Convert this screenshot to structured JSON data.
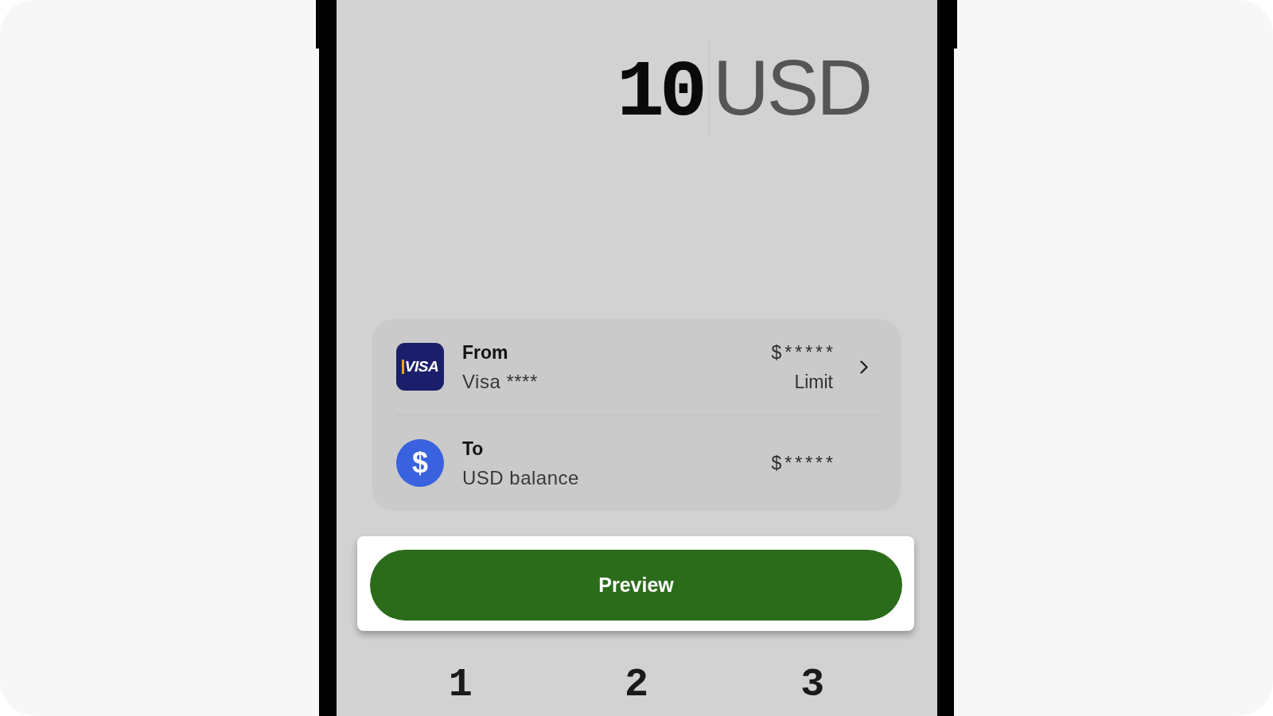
{
  "amount": {
    "value": "10",
    "currency": "USD"
  },
  "transfer": {
    "rows": [
      {
        "kind": "card",
        "logo": "VISA",
        "label": "From",
        "account": "Visa ****",
        "amount": "$*****",
        "note": "Limit"
      },
      {
        "kind": "balance",
        "logo": "$",
        "label": "To",
        "account": "USD balance",
        "amount": "$*****"
      }
    ]
  },
  "preview_button": {
    "label": "Preview",
    "highlighted": true
  },
  "keypad": {
    "keys": [
      "1",
      "2",
      "3"
    ]
  }
}
